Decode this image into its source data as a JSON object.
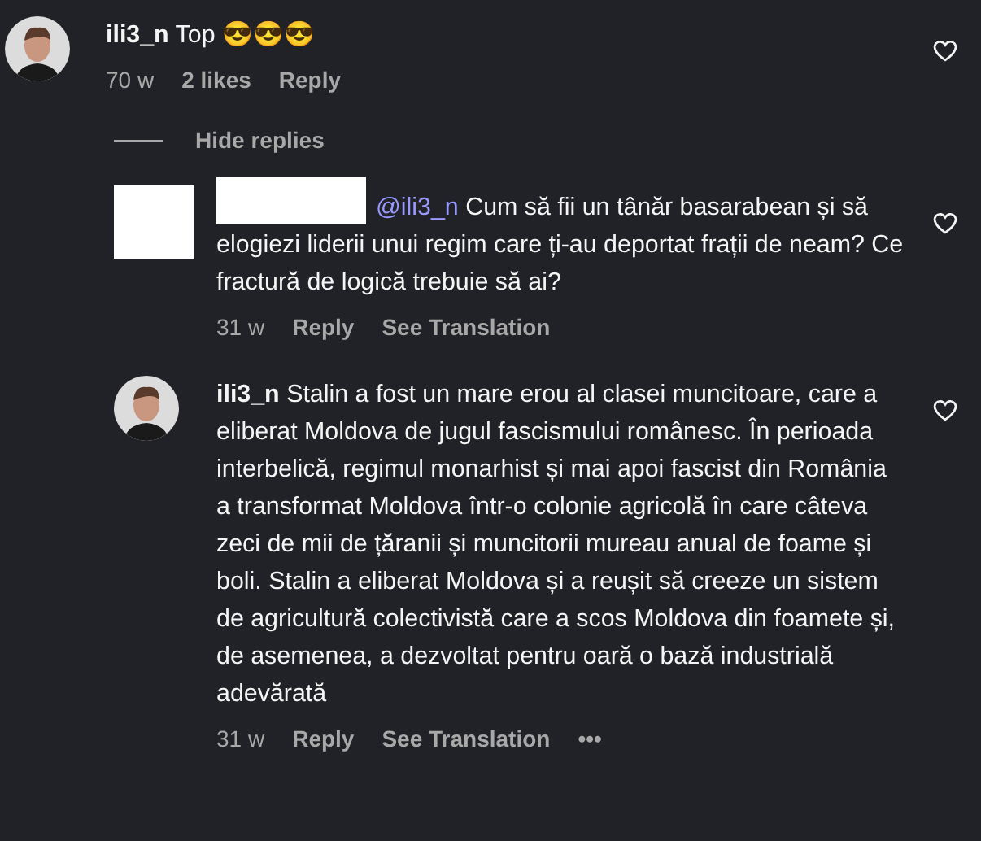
{
  "comment": {
    "avatar": {
      "kind": "photo"
    },
    "username": "ili3_n",
    "text": "Top 😎😎😎",
    "liked": false,
    "meta": [
      {
        "kind": "time",
        "label": "70 w"
      },
      {
        "kind": "likes",
        "label": "2 likes"
      },
      {
        "kind": "action",
        "label": "Reply"
      }
    ]
  },
  "hide_replies": "Hide replies",
  "replies": [
    {
      "avatar": {
        "kind": "blank"
      },
      "redacted": true,
      "mention": "@ili3_n",
      "text": "Cum să fii un tânăr basarabean și să elogiezi liderii unui regim care ți-au deportat frații de neam? Ce fractură de logică trebuie să ai?",
      "liked": false,
      "meta": [
        {
          "kind": "time",
          "label": "31 w"
        },
        {
          "kind": "action",
          "label": "Reply"
        },
        {
          "kind": "action",
          "label": "See Translation"
        }
      ]
    },
    {
      "avatar": {
        "kind": "photo"
      },
      "username": "ili3_n",
      "redacted": false,
      "text": "Stalin a fost un mare erou al clasei muncitoare, care a eliberat Moldova de jugul fascismului românesc. În perioada interbelică, regimul monarhist și mai apoi fascist din România a transformat Moldova într-o colonie agricolă în care câteva zeci de mii de țăranii și muncitorii mureau anual de foame și boli. Stalin a eliberat Moldova și a reușit să creeze un sistem de agricultură colectivistă care a scos Moldova din foamete și, de asemenea, a dezvoltat pentru oară o bază industrială adevărată",
      "liked": false,
      "meta": [
        {
          "kind": "time",
          "label": "31 w"
        },
        {
          "kind": "action",
          "label": "Reply"
        },
        {
          "kind": "action",
          "label": "See Translation"
        },
        {
          "kind": "more",
          "label": "•••"
        }
      ]
    }
  ]
}
